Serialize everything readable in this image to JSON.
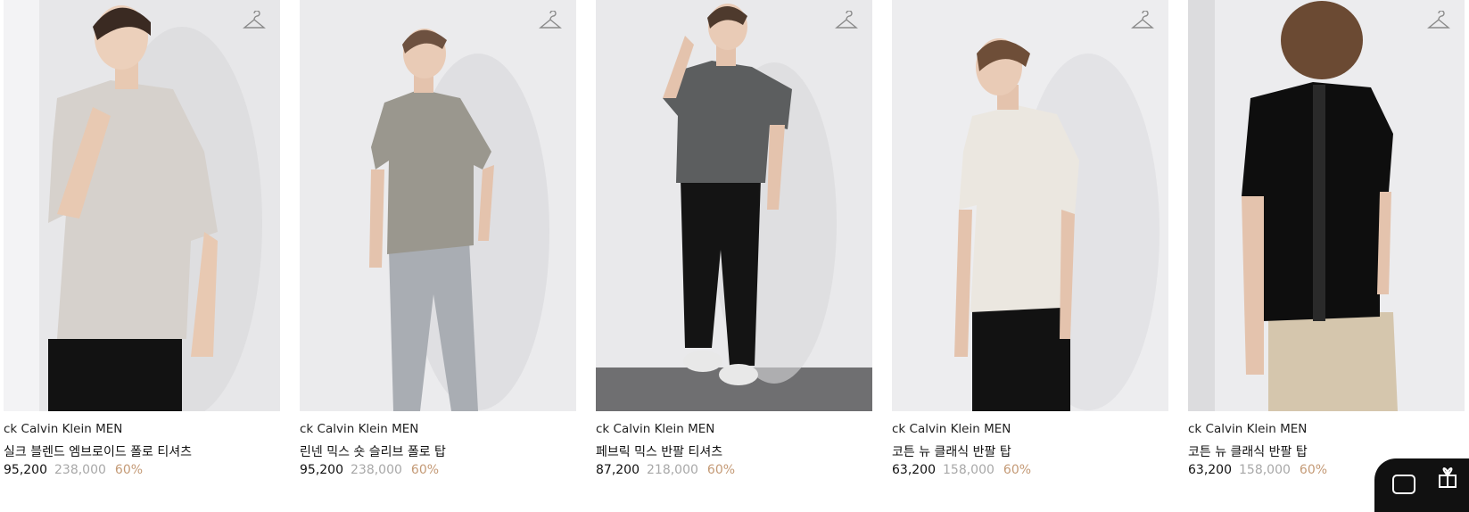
{
  "products": [
    {
      "brand": "ck Calvin Klein MEN",
      "name": "실크 블렌드 엠브로이드 폴로 티셔츠",
      "price": "95,200",
      "original": "238,000",
      "discount": "60%",
      "photo_icon": "polo-model-photo",
      "bg": "#e6e6e8",
      "shirt": "#d6d1cc",
      "pants": "#121212",
      "wall": "#cfcfd3"
    },
    {
      "brand": "ck Calvin Klein MEN",
      "name": "린넨 믹스 숏 슬리브 폴로 탑",
      "price": "95,200",
      "original": "238,000",
      "discount": "60%",
      "photo_icon": "polo-model-photo",
      "bg": "#ebebed",
      "shirt": "#9a978e",
      "pants": "#a9adb3",
      "wall": "#dcdcdf"
    },
    {
      "brand": "ck Calvin Klein MEN",
      "name": "페브릭 믹스 반팔 티셔츠",
      "price": "87,200",
      "original": "218,000",
      "discount": "60%",
      "photo_icon": "tshirt-model-photo",
      "bg": "#e9e9eb",
      "shirt": "#5c5e5f",
      "pants": "#141414",
      "wall": "#d9d9dc"
    },
    {
      "brand": "ck Calvin Klein MEN",
      "name": "코튼 뉴 클래식 반팔 탑",
      "price": "63,200",
      "original": "158,000",
      "discount": "60%",
      "photo_icon": "tshirt-model-photo",
      "bg": "#ededef",
      "shirt": "#ebe7e0",
      "pants": "#121212",
      "wall": "#dededf"
    },
    {
      "brand": "ck Calvin Klein MEN",
      "name": "코튼 뉴 클래식 반팔 탑",
      "price": "63,200",
      "original": "158,000",
      "discount": "60%",
      "photo_icon": "tshirt-back-model-photo",
      "bg": "#ececee",
      "shirt": "#0e0e0e",
      "pants": "#d5c6ad",
      "wall": "#dcdcde"
    }
  ],
  "icons": {
    "wishlist": "hanger-icon",
    "floating": "gift-icon"
  }
}
